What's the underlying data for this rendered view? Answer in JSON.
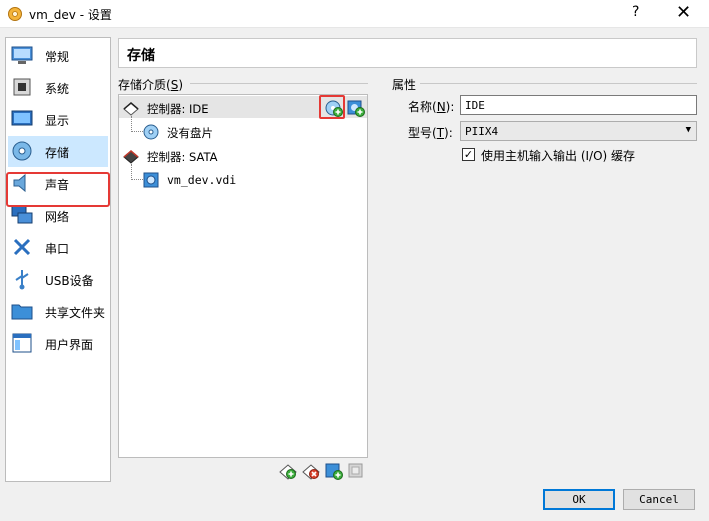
{
  "window": {
    "title": "vm_dev - 设置",
    "help_glyph": "?",
    "close_glyph": "✕"
  },
  "sidebar": {
    "items": [
      {
        "label": "常规",
        "icon": "general-icon"
      },
      {
        "label": "系统",
        "icon": "system-icon"
      },
      {
        "label": "显示",
        "icon": "display-icon"
      },
      {
        "label": "存储",
        "icon": "storage-icon",
        "selected": true
      },
      {
        "label": "声音",
        "icon": "audio-icon"
      },
      {
        "label": "网络",
        "icon": "network-icon"
      },
      {
        "label": "串口",
        "icon": "serial-port-icon"
      },
      {
        "label": "USB设备",
        "icon": "usb-icon"
      },
      {
        "label": "共享文件夹",
        "icon": "shared-folder-icon"
      },
      {
        "label": "用户界面",
        "icon": "user-interface-icon"
      }
    ]
  },
  "page": {
    "heading": "存储"
  },
  "storage_media": {
    "label": "存储介质(",
    "label_key": "S",
    "label_close": ")",
    "tree": [
      {
        "label": "控制器: IDE",
        "icon": "ide-controller-icon"
      },
      {
        "label": "没有盘片",
        "icon": "optical-disc-icon"
      },
      {
        "label": "控制器: SATA",
        "icon": "sata-controller-icon"
      },
      {
        "label": "vm_dev.vdi",
        "icon": "hard-disk-icon"
      }
    ]
  },
  "properties": {
    "section_label": "属性",
    "name_label": "名称(",
    "name_key": "N",
    "name_close": "):",
    "name_value": "IDE",
    "type_label": "型号(",
    "type_key": "T",
    "type_close": "):",
    "type_value": "PIIX4",
    "host_io_cache_label": "使用主机输入输出 (I/O) 缓存",
    "host_io_cache_checked": true,
    "check_glyph": "✓"
  },
  "buttons": {
    "ok": "OK",
    "cancel": "Cancel"
  },
  "colors": {
    "selection": "#cce8ff",
    "highlight_border": "#e53935",
    "accent": "#0078d7"
  }
}
